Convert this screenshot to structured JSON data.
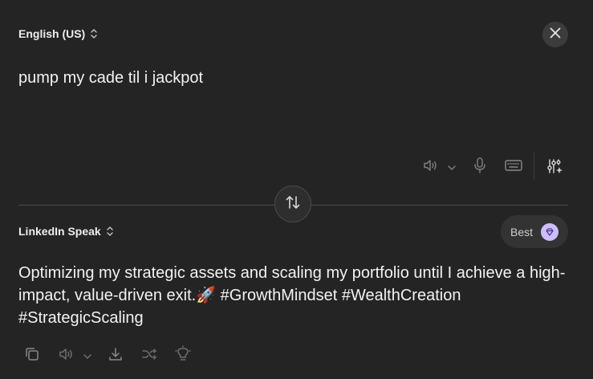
{
  "source": {
    "language": "English (US)",
    "text": "pump my cade til i jackpot"
  },
  "target": {
    "language": "LinkedIn Speak",
    "quality_label": "Best",
    "text": "Optimizing my strategic assets and scaling my portfolio until I achieve a high-impact, value-driven exit.🚀 #GrowthMindset #WealthCreation #StrategicScaling"
  },
  "icons": {
    "close": "close-icon",
    "speaker": "speaker-icon",
    "chevron": "chevron-down-icon",
    "microphone": "microphone-icon",
    "keyboard": "keyboard-icon",
    "settings": "sliders-sparkle-icon",
    "swap": "swap-vertical-icon",
    "gem": "gem-icon",
    "copy": "copy-icon",
    "download": "download-icon",
    "shuffle": "shuffle-icon",
    "bulb": "lightbulb-icon"
  },
  "colors": {
    "background": "#242424",
    "accent_gem": "#cdbdfa"
  }
}
